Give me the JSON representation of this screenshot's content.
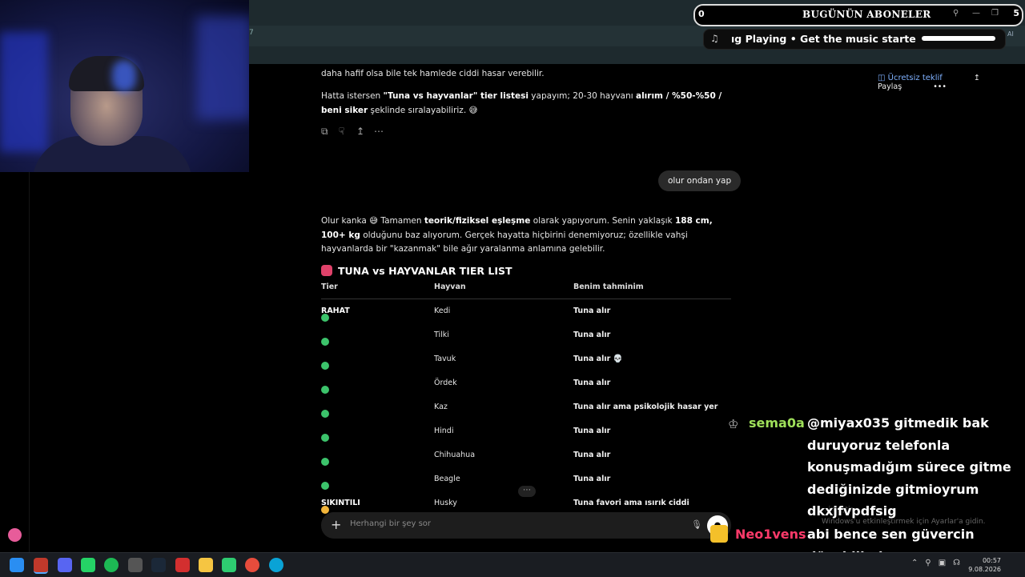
{
  "overlay": {
    "subs_count": "0",
    "subs_title": "BUGÜNÜN ABONELER",
    "subs_end": "5",
    "music_text": "ıg Playing  •  Get the music starte",
    "ai_tag": "AI",
    "tab_corner": "7"
  },
  "header": {
    "offer_label": "Ücretsiz teklif",
    "share_label": "Paylaş",
    "more_label": "•••"
  },
  "conversation": {
    "p1": "daha hafif olsa bile tek hamlede ciddi hasar verebilir.",
    "p2_pre": "Hatta istersen ",
    "p2_b1": "\"Tuna vs hayvanlar\" tier listesi",
    "p2_mid1": " yapayım; 20-30 hayvanı ",
    "p2_b2": "alırım / %50-%50 / beni siker",
    "p2_post": " şeklinde sıralayabiliriz. 😅",
    "user_msg": "olur ondan yap",
    "reply_pre": "Olur kanka 😅 Tamamen ",
    "reply_b1": "teorik/fiziksel eşleşme",
    "reply_mid1": " olarak yapıyorum. Senin yaklaşık ",
    "reply_b2": "188 cm, 100+ kg",
    "reply_post": " olduğunu baz alıyorum. Gerçek hayatta hiçbirini denemiyoruz; özellikle vahşi hayvanlarda bir \"kazanmak\" bile ağır yaralanma anlamına gelebilir.",
    "tier_title": "TUNA vs HAYVANLAR TIER LIST",
    "table_headers": [
      "Tier",
      "Hayvan",
      "Benim tahminim"
    ],
    "rows": [
      {
        "tier": "RAHAT",
        "color": "green",
        "animal": "Kedi",
        "guess": "Tuna alır"
      },
      {
        "tier": "",
        "color": "green",
        "animal": "Tilki",
        "guess": "Tuna alır"
      },
      {
        "tier": "",
        "color": "green",
        "animal": "Tavuk",
        "guess": "Tuna alır 💀"
      },
      {
        "tier": "",
        "color": "green",
        "animal": "Ördek",
        "guess": "Tuna alır"
      },
      {
        "tier": "",
        "color": "green",
        "animal": "Kaz",
        "guess": "Tuna alır ama psikolojik hasar yer"
      },
      {
        "tier": "",
        "color": "green",
        "animal": "Hindi",
        "guess": "Tuna alır"
      },
      {
        "tier": "",
        "color": "green",
        "animal": "Chihuahua",
        "guess": "Tuna alır"
      },
      {
        "tier": "",
        "color": "green",
        "animal": "Beagle",
        "guess": "Tuna alır"
      },
      {
        "tier": "SIKINTILI",
        "color": "yellow",
        "animal": "Husky",
        "guess": "Tuna favori ama ısırık ciddi"
      }
    ],
    "input_placeholder": "Herhangi bir şey sor"
  },
  "chat": {
    "user1": "sema0a",
    "msg1": "@miyax035 gitmedik bak duruyoruz telefonla konuşmadığım sürece gitme dediğinizde gitmioyrum dkxjfvpdfsig",
    "user2": "Neo1vens",
    "msg2": "abi bence sen güvercin dövebilirsin",
    "win_activate": "...inleştir\nWindows'u etkinleştirmek için Ayarlar'a gidin."
  },
  "taskbar": {
    "time": "00:57",
    "date": "9.08.2026"
  },
  "colors": {
    "green": "#3cc36b",
    "yellow": "#f2b53a",
    "chat_user1": "#9fe05a",
    "chat_user2": "#ff3a6a"
  }
}
